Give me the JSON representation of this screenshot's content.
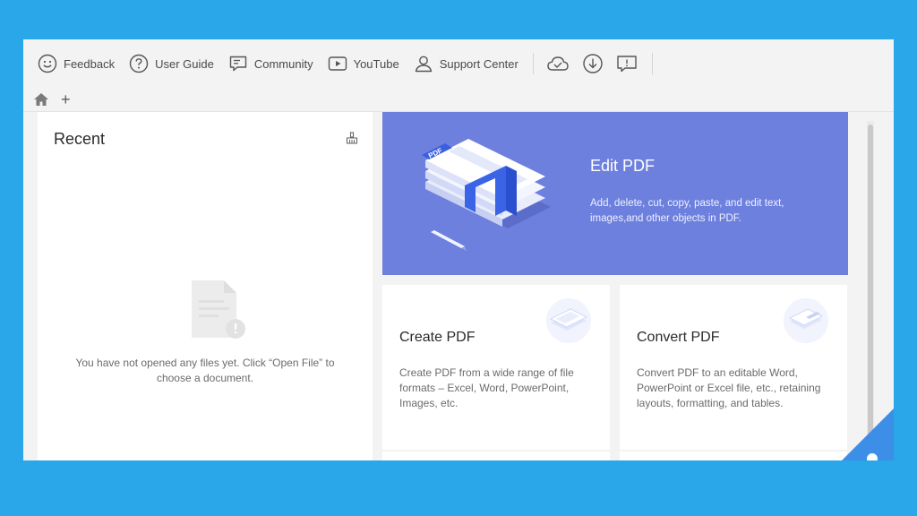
{
  "toolbar": {
    "feedback": "Feedback",
    "user_guide": "User Guide",
    "community": "Community",
    "youtube": "YouTube",
    "support_center": "Support Center"
  },
  "tabbar": {
    "add_tab": "+"
  },
  "recent": {
    "title": "Recent",
    "empty_text": "You have not opened any files yet. Click “Open File” to choose a document."
  },
  "cards": {
    "edit": {
      "title": "Edit PDF",
      "description": "Add, delete, cut, copy, paste, and edit text, images,and other objects in PDF.",
      "badge": "PDF"
    },
    "create": {
      "title": "Create PDF",
      "description": "Create PDF from a wide range of file formats – Excel, Word, PowerPoint, Images, etc."
    },
    "convert": {
      "title": "Convert PDF",
      "description": "Convert PDF to an editable Word, PowerPoint or Excel file, etc., retaining layouts, formatting, and tables."
    }
  },
  "colors": {
    "background": "#29a7e8",
    "edit_card": "#6e80dd",
    "accent_blue": "#3d8ee6"
  }
}
